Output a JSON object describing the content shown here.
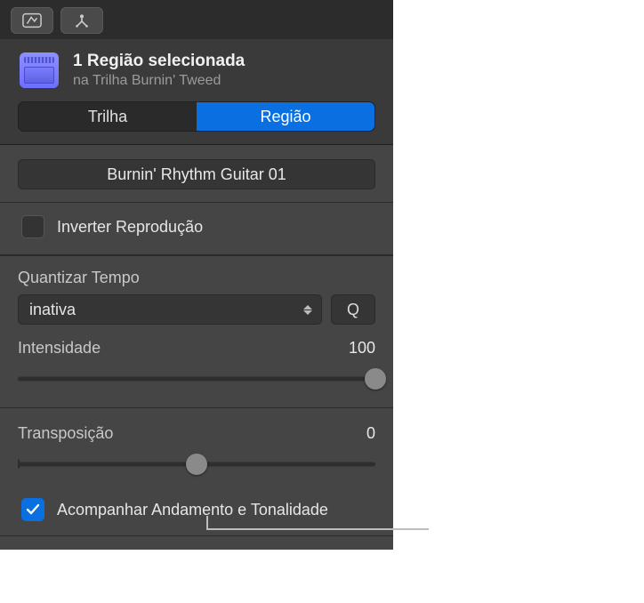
{
  "toolbar": {
    "record_enable_icon": "record-enable-icon",
    "scissors_icon": "cycle-split-icon"
  },
  "header": {
    "title": "1 Região selecionada",
    "subtitle": "na Trilha Burnin' Tweed"
  },
  "tabs": {
    "track": "Trilha",
    "region": "Região"
  },
  "region": {
    "name": "Burnin' Rhythm Guitar 01",
    "reverse_label": "Inverter Reprodução",
    "reverse_checked": false
  },
  "quantize": {
    "section_title": "Quantizar Tempo",
    "value": "inativa",
    "q_button": "Q",
    "intensity_label": "Intensidade",
    "intensity_value": "100"
  },
  "transpose": {
    "label": "Transposição",
    "value": "0"
  },
  "follow": {
    "label": "Acompanhar Andamento e Tonalidade",
    "checked": true
  }
}
